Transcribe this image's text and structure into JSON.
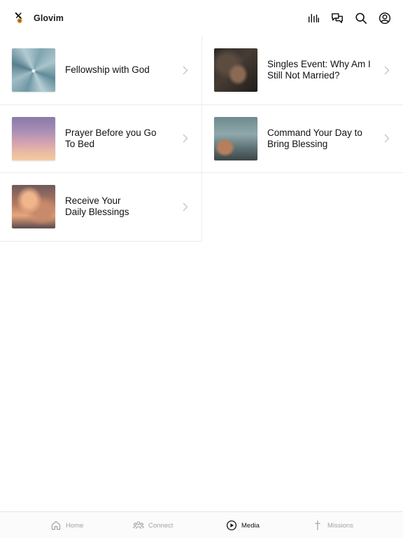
{
  "app": {
    "name": "Glovim"
  },
  "header": {
    "actions": [
      {
        "icon": "audio-bars-icon"
      },
      {
        "icon": "chat-bubbles-icon"
      },
      {
        "icon": "search-icon"
      },
      {
        "icon": "account-circle-icon"
      }
    ]
  },
  "media_items": [
    {
      "title": "Fellowship with God",
      "thumbnail": "succulent-plant-image"
    },
    {
      "title": "Singles Event: Why Am I\nStill Not Married?",
      "thumbnail": "praying-hands-image"
    },
    {
      "title": "Prayer Before you Go\nTo Bed",
      "thumbnail": "sunset-sky-image"
    },
    {
      "title": "Command Your Day to\nBring Blessing",
      "thumbnail": "hands-by-lake-image"
    },
    {
      "title": "Receive Your\nDaily Blessings",
      "thumbnail": "sunset-clouds-image"
    }
  ],
  "tabbar": {
    "tabs": [
      {
        "label": "Home",
        "icon": "home-icon",
        "active": false
      },
      {
        "label": "Connect",
        "icon": "people-icon",
        "active": false
      },
      {
        "label": "Media",
        "icon": "play-circle-icon",
        "active": true
      },
      {
        "label": "Missions",
        "icon": "cross-icon",
        "active": false
      }
    ]
  },
  "colors": {
    "text": "#111111",
    "inactive_tab": "#a2a2a6",
    "divider": "#ececec",
    "background": "#ffffff"
  }
}
